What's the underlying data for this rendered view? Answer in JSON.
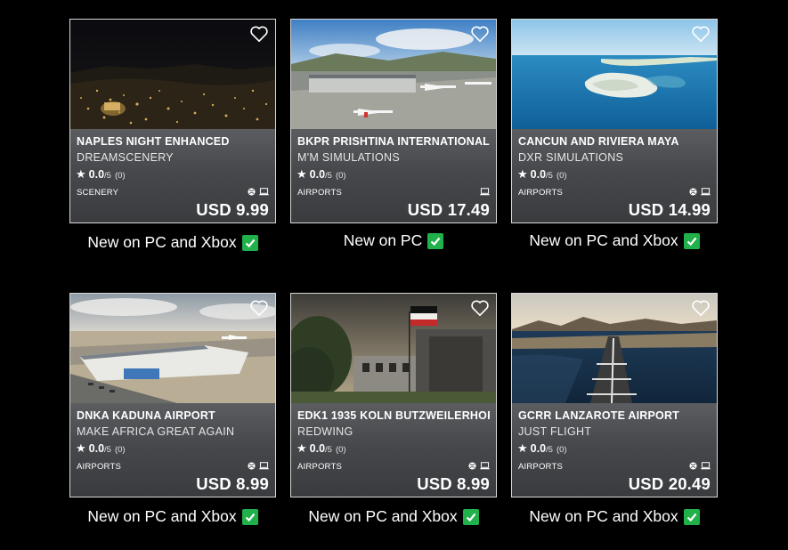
{
  "products": [
    {
      "title": "NAPLES NIGHT ENHANCED",
      "publisher": "DREAMSCENERY",
      "rating": "0.0",
      "rating_max": "/5",
      "rating_count": "(0)",
      "category": "SCENERY",
      "platforms": [
        "xbox-icon",
        "pc-icon"
      ],
      "price": "USD 9.99",
      "caption": "New on PC and Xbox",
      "image": "naples-night-city"
    },
    {
      "title": "BKPR PRISHTINA INTERNATIONAL",
      "publisher": "M'M SIMULATIONS",
      "rating": "0.0",
      "rating_max": "/5",
      "rating_count": "(0)",
      "category": "AIRPORTS",
      "platforms": [
        "pc-icon"
      ],
      "price": "USD 17.49",
      "caption": "New on PC",
      "image": "prishtina-airport-apron"
    },
    {
      "title": "CANCUN AND RIVIERA MAYA",
      "publisher": "DXR SIMULATIONS",
      "rating": "0.0",
      "rating_max": "/5",
      "rating_count": "(0)",
      "category": "AIRPORTS",
      "platforms": [
        "xbox-icon",
        "pc-icon"
      ],
      "price": "USD 14.99",
      "caption": "New on PC and Xbox",
      "image": "cancun-coastline"
    },
    {
      "title": "DNKA KADUNA AIRPORT",
      "publisher": "MAKE AFRICA GREAT AGAIN",
      "rating": "0.0",
      "rating_max": "/5",
      "rating_count": "(0)",
      "category": "AIRPORTS",
      "platforms": [
        "xbox-icon",
        "pc-icon"
      ],
      "price": "USD 8.99",
      "caption": "New on PC and Xbox",
      "image": "kaduna-terminal"
    },
    {
      "title": "EDK1 1935 KOLN BUTZWEILERHOF",
      "publisher": "REDWING",
      "rating": "0.0",
      "rating_max": "/5",
      "rating_count": "(0)",
      "category": "AIRPORTS",
      "platforms": [
        "xbox-icon",
        "pc-icon"
      ],
      "price": "USD 8.99",
      "caption": "New on PC and Xbox",
      "image": "koln-historic-building"
    },
    {
      "title": "GCRR LANZAROTE AIRPORT",
      "publisher": "JUST FLIGHT",
      "rating": "0.0",
      "rating_max": "/5",
      "rating_count": "(0)",
      "category": "AIRPORTS",
      "platforms": [
        "xbox-icon",
        "pc-icon"
      ],
      "price": "USD 20.49",
      "caption": "New on PC and Xbox",
      "image": "lanzarote-runway-sea"
    }
  ],
  "colors": {
    "background": "#000000",
    "card_info": "#46484c",
    "check_green": "#21b14b"
  }
}
